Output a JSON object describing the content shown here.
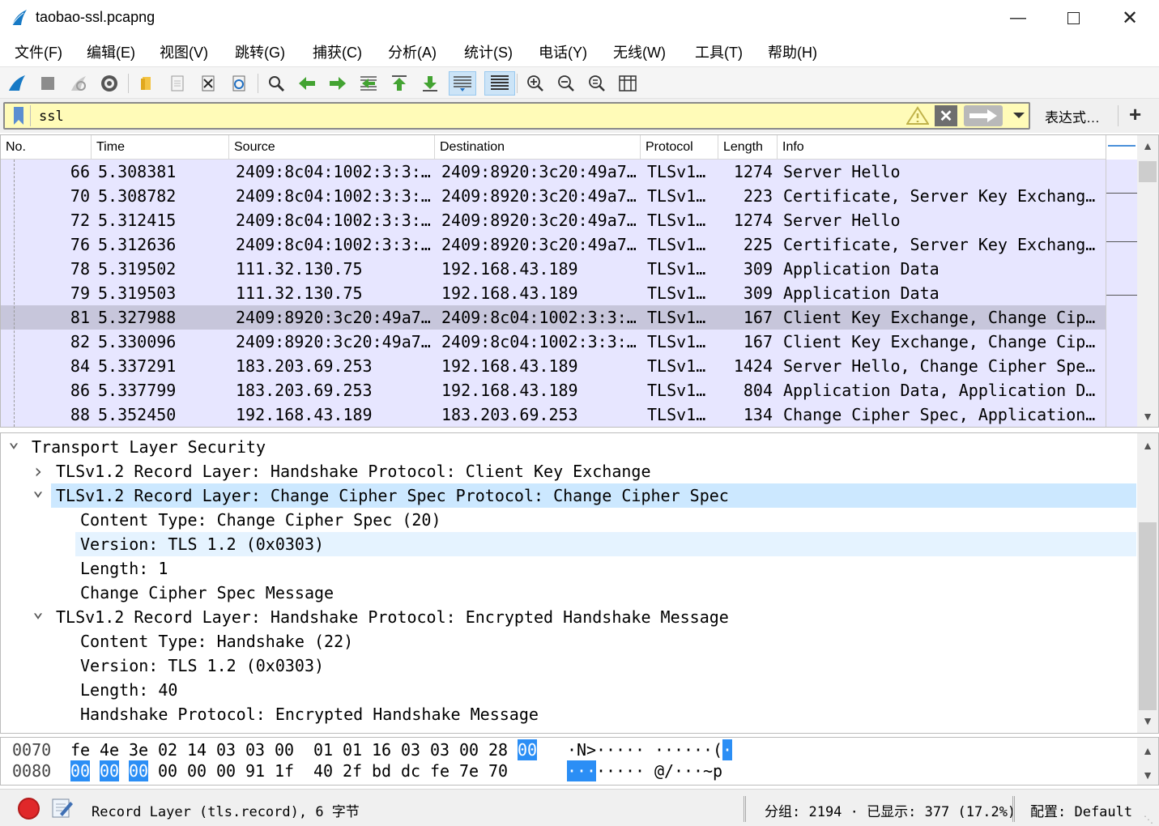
{
  "window": {
    "title": "taobao-ssl.pcapng"
  },
  "menu": [
    "文件(F)",
    "编辑(E)",
    "视图(V)",
    "跳转(G)",
    "捕获(C)",
    "分析(A)",
    "统计(S)",
    "电话(Y)",
    "无线(W)",
    "工具(T)",
    "帮助(H)"
  ],
  "filter": {
    "value": "ssl",
    "expression_label": "表达式…",
    "add_label": "+"
  },
  "packet_list": {
    "columns": [
      "No.",
      "Time",
      "Source",
      "Destination",
      "Protocol",
      "Length",
      "Info"
    ],
    "rows": [
      {
        "no": "66",
        "time": "5.308381",
        "src": "2409:8c04:1002:3:3:…",
        "dst": "2409:8920:3c20:49a7…",
        "proto": "TLSv1…",
        "len": "1274",
        "info": "Server Hello"
      },
      {
        "no": "70",
        "time": "5.308782",
        "src": "2409:8c04:1002:3:3:…",
        "dst": "2409:8920:3c20:49a7…",
        "proto": "TLSv1…",
        "len": "223",
        "info": "Certificate, Server Key Exchang…"
      },
      {
        "no": "72",
        "time": "5.312415",
        "src": "2409:8c04:1002:3:3:…",
        "dst": "2409:8920:3c20:49a7…",
        "proto": "TLSv1…",
        "len": "1274",
        "info": "Server Hello"
      },
      {
        "no": "76",
        "time": "5.312636",
        "src": "2409:8c04:1002:3:3:…",
        "dst": "2409:8920:3c20:49a7…",
        "proto": "TLSv1…",
        "len": "225",
        "info": "Certificate, Server Key Exchang…"
      },
      {
        "no": "78",
        "time": "5.319502",
        "src": "111.32.130.75",
        "dst": "192.168.43.189",
        "proto": "TLSv1…",
        "len": "309",
        "info": "Application Data"
      },
      {
        "no": "79",
        "time": "5.319503",
        "src": "111.32.130.75",
        "dst": "192.168.43.189",
        "proto": "TLSv1…",
        "len": "309",
        "info": "Application Data"
      },
      {
        "no": "81",
        "time": "5.327988",
        "src": "2409:8920:3c20:49a7…",
        "dst": "2409:8c04:1002:3:3:…",
        "proto": "TLSv1…",
        "len": "167",
        "info": "Client Key Exchange, Change Cip…",
        "selected": true
      },
      {
        "no": "82",
        "time": "5.330096",
        "src": "2409:8920:3c20:49a7…",
        "dst": "2409:8c04:1002:3:3:…",
        "proto": "TLSv1…",
        "len": "167",
        "info": "Client Key Exchange, Change Cip…"
      },
      {
        "no": "84",
        "time": "5.337291",
        "src": "183.203.69.253",
        "dst": "192.168.43.189",
        "proto": "TLSv1…",
        "len": "1424",
        "info": "Server Hello, Change Cipher Spe…"
      },
      {
        "no": "86",
        "time": "5.337799",
        "src": "183.203.69.253",
        "dst": "192.168.43.189",
        "proto": "TLSv1…",
        "len": "804",
        "info": "Application Data, Application D…"
      },
      {
        "no": "88",
        "time": "5.352450",
        "src": "192.168.43.189",
        "dst": "183.203.69.253",
        "proto": "TLSv1…",
        "len": "134",
        "info": "Change Cipher Spec, Application…"
      }
    ]
  },
  "details": [
    {
      "level": 0,
      "twisty": "down",
      "text": "Transport Layer Security"
    },
    {
      "level": 1,
      "twisty": "right",
      "text": "TLSv1.2 Record Layer: Handshake Protocol: Client Key Exchange"
    },
    {
      "level": 1,
      "twisty": "down",
      "text": "TLSv1.2 Record Layer: Change Cipher Spec Protocol: Change Cipher Spec",
      "state": "selected"
    },
    {
      "level": 2,
      "twisty": "",
      "text": "Content Type: Change Cipher Spec (20)"
    },
    {
      "level": 2,
      "twisty": "",
      "text": "Version: TLS 1.2 (0x0303)",
      "state": "hover"
    },
    {
      "level": 2,
      "twisty": "",
      "text": "Length: 1"
    },
    {
      "level": 2,
      "twisty": "",
      "text": "Change Cipher Spec Message"
    },
    {
      "level": 1,
      "twisty": "down",
      "text": "TLSv1.2 Record Layer: Handshake Protocol: Encrypted Handshake Message"
    },
    {
      "level": 2,
      "twisty": "",
      "text": "Content Type: Handshake (22)"
    },
    {
      "level": 2,
      "twisty": "",
      "text": "Version: TLS 1.2 (0x0303)"
    },
    {
      "level": 2,
      "twisty": "",
      "text": "Length: 40"
    },
    {
      "level": 2,
      "twisty": "",
      "text": "Handshake Protocol: Encrypted Handshake Message"
    }
  ],
  "bytes": [
    {
      "offset": "0070",
      "hex": [
        "fe",
        "4e",
        "3e",
        "02",
        "14",
        "03",
        "03",
        "00",
        "01",
        "01",
        "16",
        "03",
        "03",
        "00",
        "28",
        "00"
      ],
      "ascii": [
        "·",
        "N",
        ">",
        "·",
        "·",
        "·",
        "·",
        "·",
        "·",
        "·",
        "·",
        "·",
        "·",
        "·",
        "(",
        "·"
      ],
      "hl": [
        false,
        false,
        false,
        false,
        false,
        false,
        false,
        false,
        false,
        false,
        false,
        false,
        false,
        false,
        false,
        true
      ]
    },
    {
      "offset": "0080",
      "hex": [
        "00",
        "00",
        "00",
        "00",
        "00",
        "00",
        "91",
        "1f",
        "40",
        "2f",
        "bd",
        "dc",
        "fe",
        "7e",
        "70"
      ],
      "ascii": [
        "·",
        "·",
        "·",
        "·",
        "·",
        "·",
        "·",
        "·",
        "@",
        "/",
        "·",
        "·",
        "·",
        "~",
        "p"
      ],
      "hl": [
        true,
        true,
        true,
        false,
        false,
        false,
        false,
        false,
        false,
        false,
        false,
        false,
        false,
        false,
        false
      ]
    }
  ],
  "status": {
    "field_info": "Record Layer (tls.record), 6 字节",
    "packets_info": "分组: 2194 · 已显示: 377 (17.2%)",
    "profile": "配置: Default"
  },
  "colors": {
    "row_tls": "#e7e6ff",
    "row_selected": "#c7c6db",
    "filter_bg": "#fffbb8",
    "detail_selected": "#cce8ff",
    "byte_highlight": "#2b8ef5"
  },
  "icons": [
    "shark-fin-icon",
    "stop-capture-icon",
    "restart-capture-icon",
    "capture-options-icon",
    "open-file-icon",
    "save-file-icon",
    "close-file-icon",
    "reload-file-icon",
    "find-packet-icon",
    "go-back-icon",
    "go-forward-icon",
    "go-to-packet-icon",
    "first-packet-icon",
    "last-packet-icon",
    "autoscroll-icon",
    "colorize-icon",
    "zoom-in-icon",
    "zoom-out-icon",
    "zoom-normal-icon",
    "resize-columns-icon"
  ]
}
